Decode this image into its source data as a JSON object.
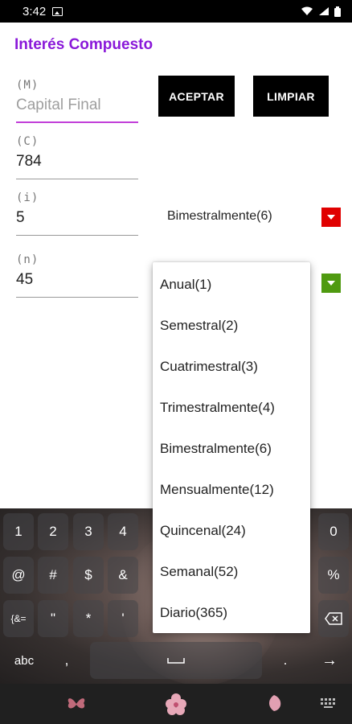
{
  "status": {
    "time": "3:42"
  },
  "app": {
    "title": "Interés Compuesto"
  },
  "fields": {
    "m": {
      "hint": "(M)",
      "placeholder": "Capital Final"
    },
    "c": {
      "hint": "(C)",
      "value": "784"
    },
    "i": {
      "hint": "(i)",
      "value": "5"
    },
    "n": {
      "hint": "(n)",
      "value": "45"
    }
  },
  "buttons": {
    "accept": "ACEPTAR",
    "clear": "LIMPIAR"
  },
  "spinner": {
    "selected": "Bimestralmente(6)"
  },
  "dropdown_options": [
    "Anual(1)",
    "Semestral(2)",
    "Cuatrimestral(3)",
    "Trimestralmente(4)",
    "Bimestralmente(6)",
    "Mensualmente(12)",
    "Quincenal(24)",
    "Semanal(52)",
    "Diario(365)"
  ],
  "keyboard": {
    "row1": [
      "1",
      "2",
      "3",
      "4",
      "0"
    ],
    "row2": [
      "@",
      "#",
      "$",
      "&",
      "%"
    ],
    "row3": [
      "{&=",
      "\"",
      "*",
      "'"
    ],
    "abc": "abc",
    "comma": ",",
    "period": ".",
    "enter": "→"
  },
  "colors": {
    "accent": "#8a19d9",
    "arrow_red": "#e00000",
    "arrow_green": "#4f9a10"
  }
}
